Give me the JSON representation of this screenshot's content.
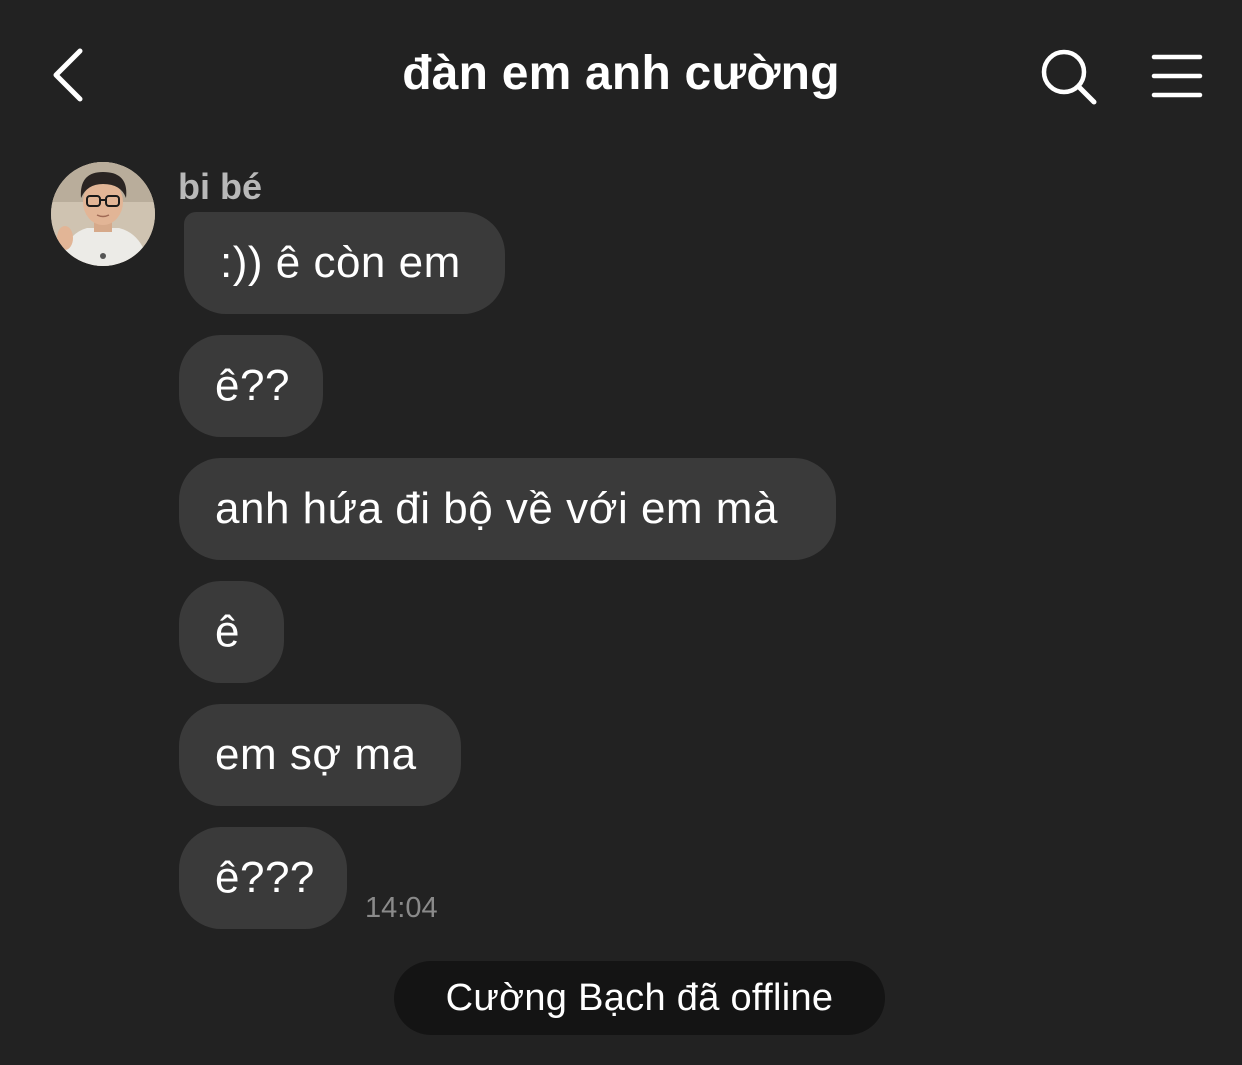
{
  "header": {
    "title": "đàn em anh cường",
    "back_icon": "chevron-left-icon",
    "search_icon": "search-icon",
    "menu_icon": "hamburger-menu-icon"
  },
  "conversation": {
    "sender_name": "bi bé",
    "messages": [
      {
        "text": ":)) ê còn em"
      },
      {
        "text": "ê??"
      },
      {
        "text": "anh hứa đi bộ về với em mà"
      },
      {
        "text": "ê"
      },
      {
        "text": "em sợ ma"
      },
      {
        "text": "ê???"
      }
    ],
    "last_timestamp": "14:04"
  },
  "status": {
    "text": "Cường Bạch đã offline"
  },
  "colors": {
    "background": "#222222",
    "bubble": "#3a3a3a",
    "status_pill": "#141414",
    "muted_text": "#8a8a8a"
  }
}
